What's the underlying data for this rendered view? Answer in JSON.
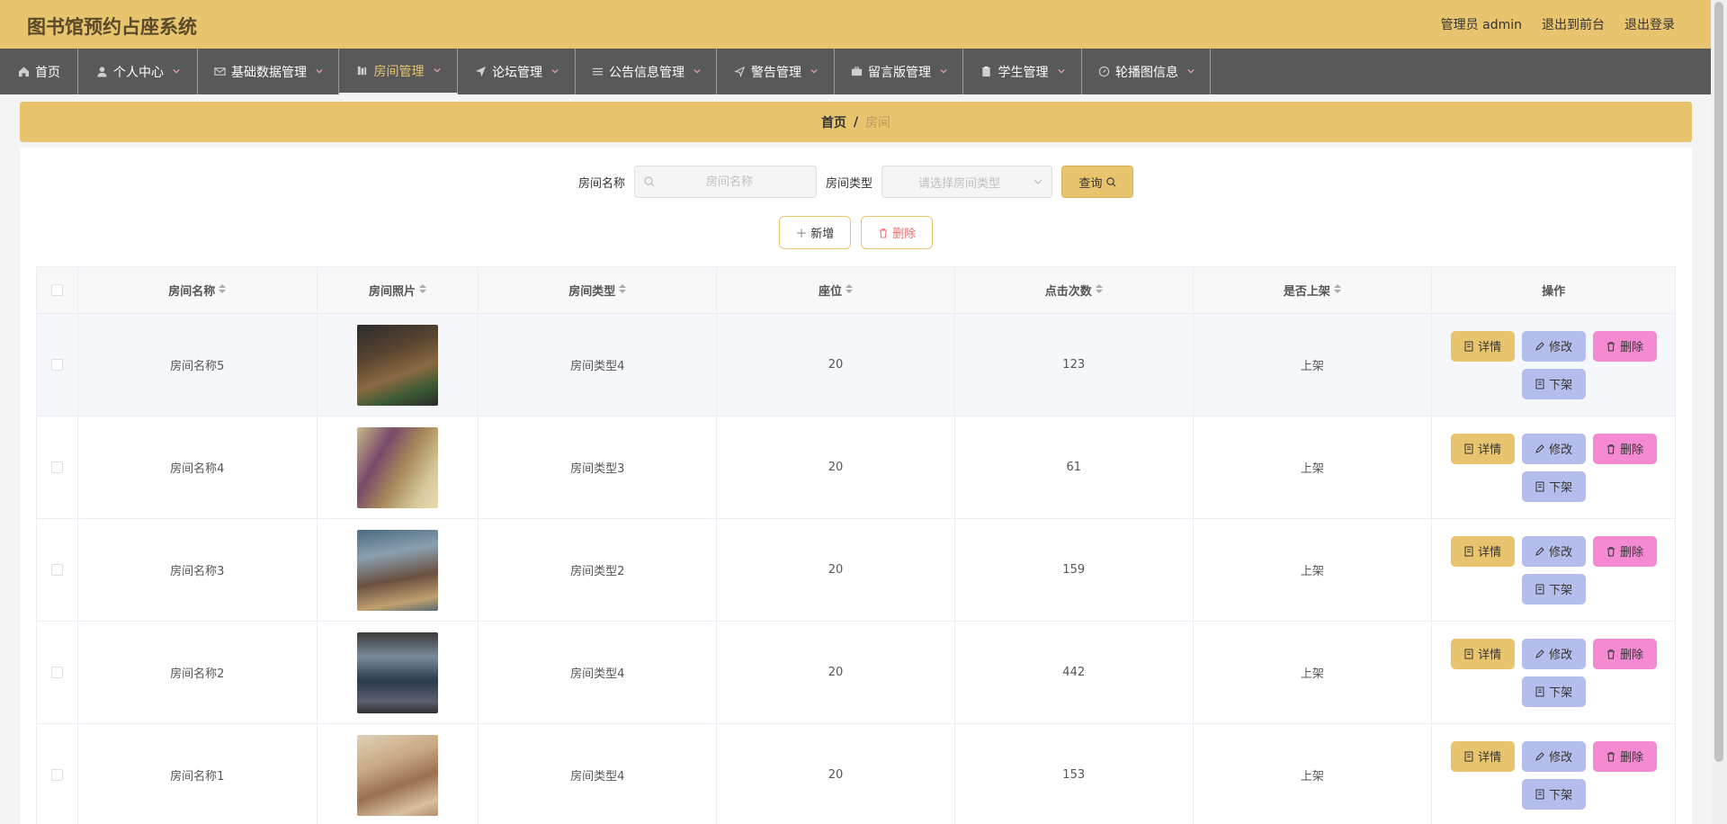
{
  "header": {
    "title": "图书馆预约占座系统",
    "admin": "管理员 admin",
    "to_front": "退出到前台",
    "logout": "退出登录"
  },
  "nav": [
    {
      "label": "首页",
      "icon": "home-icon",
      "width": 87,
      "chev": false
    },
    {
      "label": "个人中心",
      "icon": "user-icon",
      "width": 133,
      "chev": true
    },
    {
      "label": "基础数据管理",
      "icon": "mail-icon",
      "width": 157,
      "chev": true
    },
    {
      "label": "房间管理",
      "icon": "building-icon",
      "width": 132,
      "chev": true,
      "active": true
    },
    {
      "label": "论坛管理",
      "icon": "send-icon",
      "width": 131,
      "chev": true
    },
    {
      "label": "公告信息管理",
      "icon": "list-icon",
      "width": 157,
      "chev": true
    },
    {
      "label": "警告管理",
      "icon": "arrow-icon",
      "width": 131,
      "chev": true
    },
    {
      "label": "留言版管理",
      "icon": "briefcase-icon",
      "width": 143,
      "chev": true
    },
    {
      "label": "学生管理",
      "icon": "clipboard-icon",
      "width": 132,
      "chev": true
    },
    {
      "label": "轮播图信息",
      "icon": "compass-icon",
      "width": 143,
      "chev": true
    }
  ],
  "breadcrumb": {
    "home": "首页",
    "sep": "/",
    "current": "房间"
  },
  "search": {
    "name_label": "房间名称",
    "name_placeholder": "房间名称",
    "type_label": "房间类型",
    "type_placeholder": "请选择房间类型",
    "query_label": "查询"
  },
  "actions": {
    "add_label": "新增",
    "delete_label": "删除"
  },
  "table": {
    "headers": [
      "房间名称",
      "房间照片",
      "房间类型",
      "座位",
      "点击次数",
      "是否上架",
      "操作"
    ],
    "ops": {
      "detail": "详情",
      "edit": "修改",
      "delete": "删除",
      "off": "下架"
    },
    "rows": [
      {
        "name": "房间名称5",
        "type": "房间类型4",
        "seats": "20",
        "clicks": "123",
        "status": "上架"
      },
      {
        "name": "房间名称4",
        "type": "房间类型3",
        "seats": "20",
        "clicks": "61",
        "status": "上架"
      },
      {
        "name": "房间名称3",
        "type": "房间类型2",
        "seats": "20",
        "clicks": "159",
        "status": "上架"
      },
      {
        "name": "房间名称2",
        "type": "房间类型4",
        "seats": "20",
        "clicks": "442",
        "status": "上架"
      },
      {
        "name": "房间名称1",
        "type": "房间类型4",
        "seats": "20",
        "clicks": "153",
        "status": "上架"
      }
    ]
  },
  "colors": {
    "accent": "#e8c46e",
    "nav_bg": "#595959",
    "edit": "#b4bdec",
    "delete": "#f58ad2"
  }
}
